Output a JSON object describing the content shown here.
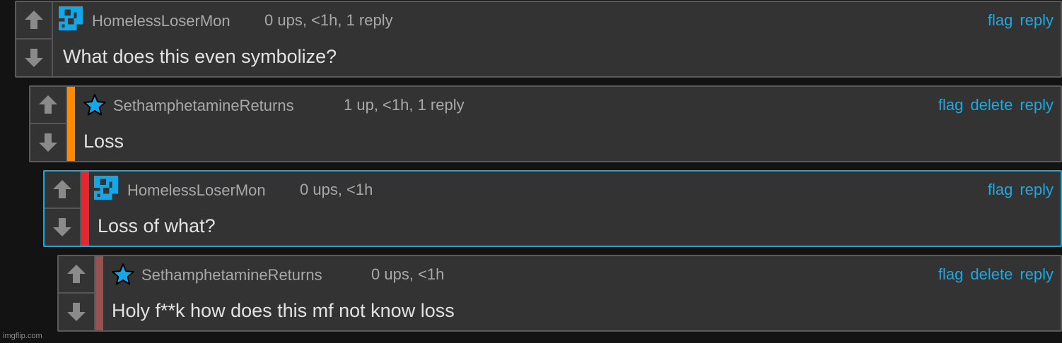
{
  "comments": [
    {
      "author": "HomelessLoserMon",
      "meta": "0 ups, <1h, 1 reply",
      "text": "What does this even symbolize?",
      "avatar": "pixel-avatar",
      "actions": [
        "flag",
        "reply"
      ]
    },
    {
      "author": "SethamphetamineReturns",
      "meta": "1 up, <1h, 1 reply",
      "text": "Loss",
      "avatar": "star-icon",
      "stripe_color": "#ff8a00",
      "actions": [
        "flag",
        "delete",
        "reply"
      ]
    },
    {
      "author": "HomelessLoserMon",
      "meta": "0 ups, <1h",
      "text": "Loss of what?",
      "avatar": "pixel-avatar",
      "stripe_color": "#e8262e",
      "actions": [
        "flag",
        "reply"
      ]
    },
    {
      "author": "SethamphetamineReturns",
      "meta": "0 ups, <1h",
      "text": "Holy f**k how does this mf not know loss",
      "avatar": "star-icon",
      "stripe_color": "#9b5050",
      "actions": [
        "flag",
        "delete",
        "reply"
      ]
    }
  ],
  "colors": {
    "background": "#131313",
    "panel": "#333333",
    "link": "#1ea8e0",
    "highlight_border": "#1ea8d8",
    "avatar_blue": "#13a7e8"
  },
  "watermark": "imgflip.com"
}
